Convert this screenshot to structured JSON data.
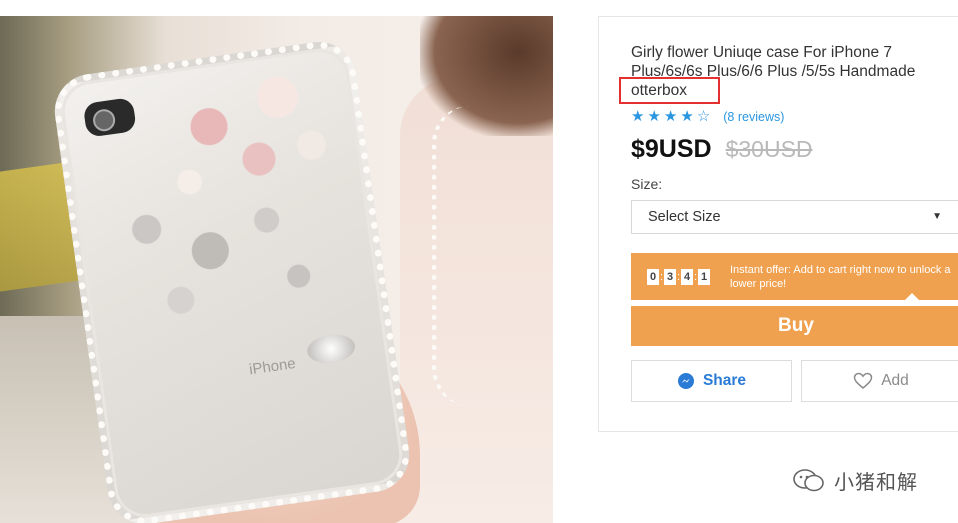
{
  "product": {
    "title_line1": "Girly flower Uniuqe case For iPhone 7",
    "title_line2": "Plus/6s/6s Plus/6/6 Plus /5/5s Handmade",
    "brand": "otterbox",
    "rating": {
      "stars": 4,
      "max": 5,
      "reviews_text": "(8 reviews)"
    },
    "price_now": "$9USD",
    "price_was": "$30USD"
  },
  "size": {
    "label": "Size:",
    "selected": "Select Size"
  },
  "offer": {
    "timer_digits": [
      "0",
      "3",
      "4",
      "1"
    ],
    "text": "Instant offer: Add to cart right now to unlock a lower price!"
  },
  "actions": {
    "buy": "Buy",
    "share": "Share",
    "add": "Add"
  },
  "photo": {
    "case_logo": "iPhone"
  },
  "watermark": {
    "text": "小猪和解"
  },
  "colors": {
    "accent_orange": "#f0a14f",
    "link_blue": "#2a96e0",
    "highlight_red": "#e53030"
  }
}
